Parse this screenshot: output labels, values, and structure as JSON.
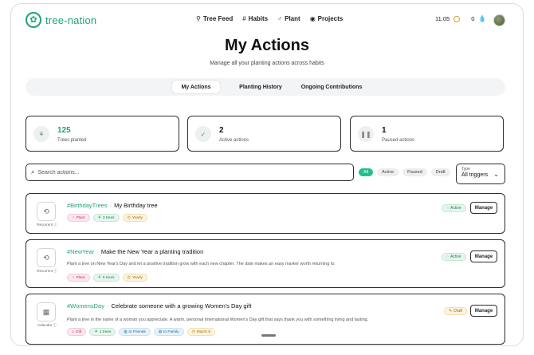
{
  "brand": {
    "name": "tree-nation",
    "color": "#1fa37a"
  },
  "nav": [
    {
      "label": "Tree Feed",
      "icon": "tree-feed-icon",
      "glyph": "⚲"
    },
    {
      "label": "Habits",
      "icon": "hashtag-icon",
      "glyph": "#"
    },
    {
      "label": "Plant",
      "icon": "plant-icon",
      "glyph": "♂"
    },
    {
      "label": "Projects",
      "icon": "globe-icon",
      "glyph": "◉"
    }
  ],
  "header": {
    "balance": "11.05",
    "drops": "0"
  },
  "page": {
    "title": "My Actions",
    "subtitle": "Manage all your planting actions across habits"
  },
  "tabs": [
    "My Actions",
    "Planting History",
    "Ongoing Contributions"
  ],
  "stats": [
    {
      "value": "125",
      "label": "Trees planted",
      "icon": "sprout-icon"
    },
    {
      "value": "2",
      "label": "Active actions",
      "icon": "check-circle-icon"
    },
    {
      "value": "1",
      "label": "Paused actions",
      "icon": "pause-icon"
    }
  ],
  "search": {
    "placeholder": "Search actions..."
  },
  "filters": [
    "All",
    "Active",
    "Paused",
    "Draft"
  ],
  "type_filter": {
    "label": "Type",
    "value": "All triggers"
  },
  "actions": [
    {
      "caption": "Recurrent ⓘ",
      "hashtag": "#BirthdayTrees",
      "title": "My Birthday tree",
      "description": "",
      "status": "Active",
      "manage": "Manage",
      "tags": [
        "Plant",
        "3 trees",
        "Yearly"
      ]
    },
    {
      "caption": "Recurrent ⓘ",
      "hashtag": "#NewYear",
      "title": "Make the New Year a planting tradition",
      "description": "Plant a tree on New Year's Day and let a positive tradition grow with each new chapter. The date makes an easy marker worth returning to.",
      "status": "Active",
      "manage": "Manage",
      "tags": [
        "Plant",
        "5 trees",
        "Yearly"
      ]
    },
    {
      "caption": "Calendar ⓘ",
      "hashtag": "#WomensDay",
      "title": "Celebrate someone with a growing Women's Day gift",
      "description": "Plant a tree in the name of a woman you appreciate. A warm, personal International Women's Day gift that says thank you with something living and lasting.",
      "status": "Draft",
      "manage": "Manage",
      "tags": [
        "Gift",
        "1 trees",
        "to Friends",
        "to Family",
        "March 8"
      ]
    }
  ]
}
